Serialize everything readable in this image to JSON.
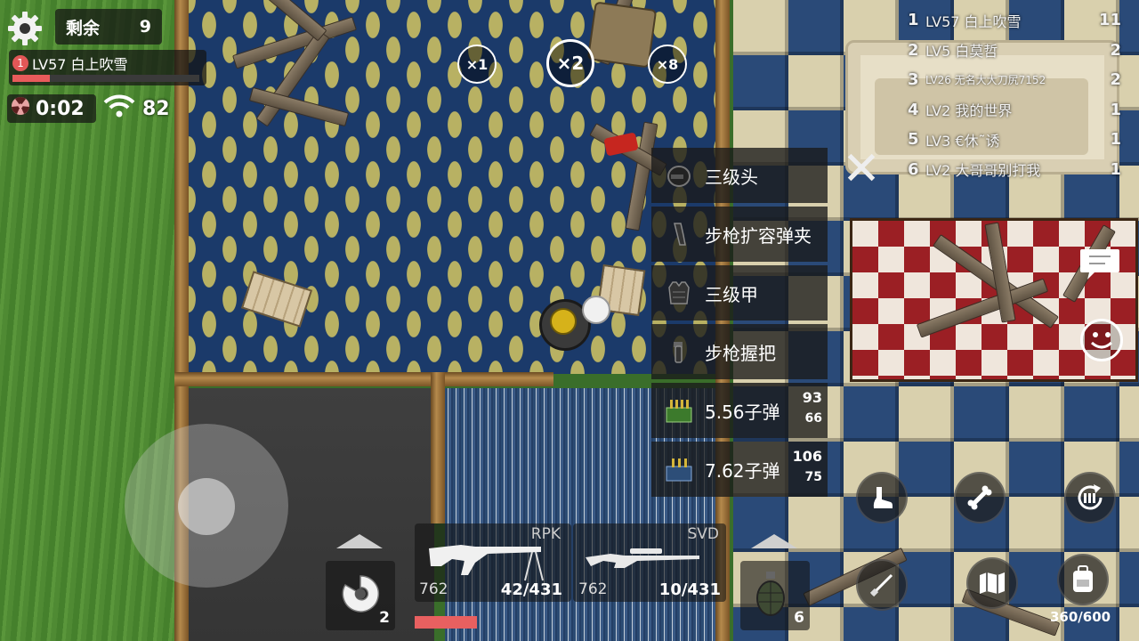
{
  "hud": {
    "remaining_label": "剩余",
    "remaining_count": "9",
    "player_level_name": "LV57 白上吹雪",
    "player_badge": "1",
    "player_health_fraction": 0.2,
    "zone_timer": "0:02",
    "ping": "82"
  },
  "scopes": [
    {
      "label": "×1",
      "active": false
    },
    {
      "label": "×2",
      "active": true
    },
    {
      "label": "×8",
      "active": false
    }
  ],
  "leaderboard": [
    {
      "rank": "1",
      "name": "LV57 白上吹雪",
      "kills": "11"
    },
    {
      "rank": "2",
      "name": "LV5 白莫哲",
      "kills": "2"
    },
    {
      "rank": "3",
      "name": "LV26 无名大大刀尻7152",
      "kills": "2"
    },
    {
      "rank": "4",
      "name": "LV2 我的世界",
      "kills": "1"
    },
    {
      "rank": "5",
      "name": "LV3 €休˜诱",
      "kills": "1"
    },
    {
      "rank": "6",
      "name": "LV2 大哥哥别打我",
      "kills": "1"
    }
  ],
  "loot": [
    {
      "name": "三级头",
      "icon": "helmet-icon"
    },
    {
      "name": "步枪扩容弹夹",
      "icon": "magazine-icon"
    },
    {
      "name": "三级甲",
      "icon": "vest-icon"
    },
    {
      "name": "步枪握把",
      "icon": "grip-icon"
    },
    {
      "name": "5.56子弹",
      "icon": "ammo-556-icon",
      "count_top": "93",
      "count_bottom": "66"
    },
    {
      "name": "7.62子弹",
      "icon": "ammo-762-icon",
      "count_top": "106",
      "count_bottom": "75"
    }
  ],
  "weapons": {
    "primary": {
      "name": "RPK",
      "ammo_type": "762",
      "ammo": "42/431"
    },
    "secondary": {
      "name": "SVD",
      "ammo_type": "762",
      "ammo": "10/431"
    },
    "weapon_health_fraction": 0.2
  },
  "items": {
    "heal_count": "2",
    "grenade_count": "6",
    "backpack_capacity": "360/600"
  },
  "colors": {
    "health_red": "#e85b5b",
    "carpet_blue": "#1b3a6a",
    "carpet_gold": "#b8b163"
  }
}
